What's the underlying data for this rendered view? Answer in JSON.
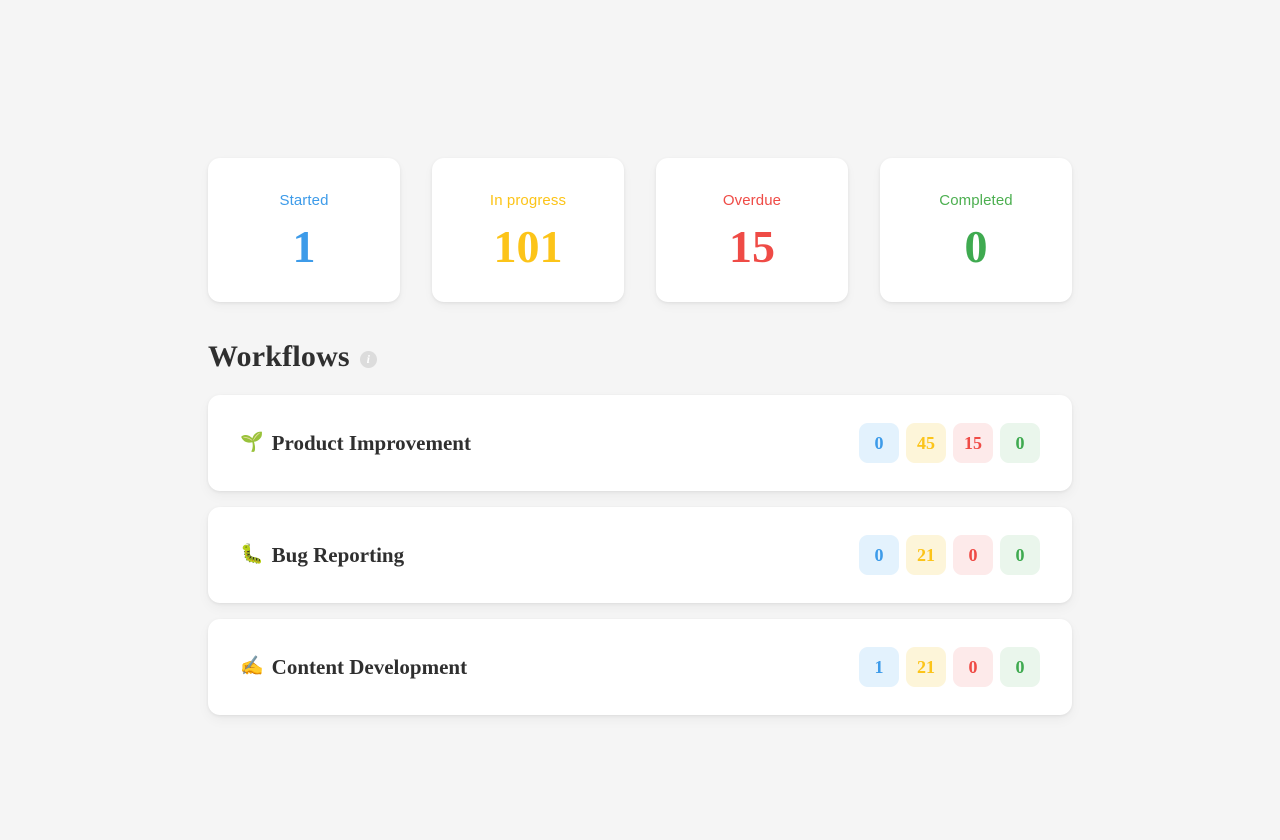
{
  "stats": [
    {
      "label": "Started",
      "value": "1",
      "color": "#3d9be9",
      "key": "started"
    },
    {
      "label": "In progress",
      "value": "101",
      "color": "#fcc419",
      "key": "inprogress"
    },
    {
      "label": "Overdue",
      "value": "15",
      "color": "#ef4b46",
      "key": "overdue"
    },
    {
      "label": "Completed",
      "value": "0",
      "color": "#3faa50",
      "key": "completed"
    }
  ],
  "section": {
    "title": "Workflows",
    "info_icon": "info-icon",
    "info_glyph": "i"
  },
  "workflows": [
    {
      "emoji": "🌱",
      "emoji_name": "seedling-emoji",
      "name": "Product Improvement",
      "counts": {
        "started": "0",
        "inprogress": "45",
        "overdue": "15",
        "completed": "0"
      }
    },
    {
      "emoji": "🐛",
      "emoji_name": "bug-emoji",
      "name": "Bug Reporting",
      "counts": {
        "started": "0",
        "inprogress": "21",
        "overdue": "0",
        "completed": "0"
      }
    },
    {
      "emoji": "✍️",
      "emoji_name": "writing-hand-emoji",
      "name": "Content Development",
      "counts": {
        "started": "1",
        "inprogress": "21",
        "overdue": "0",
        "completed": "0"
      }
    }
  ],
  "colors": {
    "background": "#f5f5f5",
    "card": "#ffffff",
    "started": "#3d9be9",
    "inprogress": "#fcc419",
    "overdue": "#ef4b46",
    "completed": "#3faa50",
    "started_bg": "#e3f2fd",
    "inprogress_bg": "#fdf5d9",
    "overdue_bg": "#fdeaea",
    "completed_bg": "#eaf6ec",
    "heading": "#2f2f2f"
  }
}
